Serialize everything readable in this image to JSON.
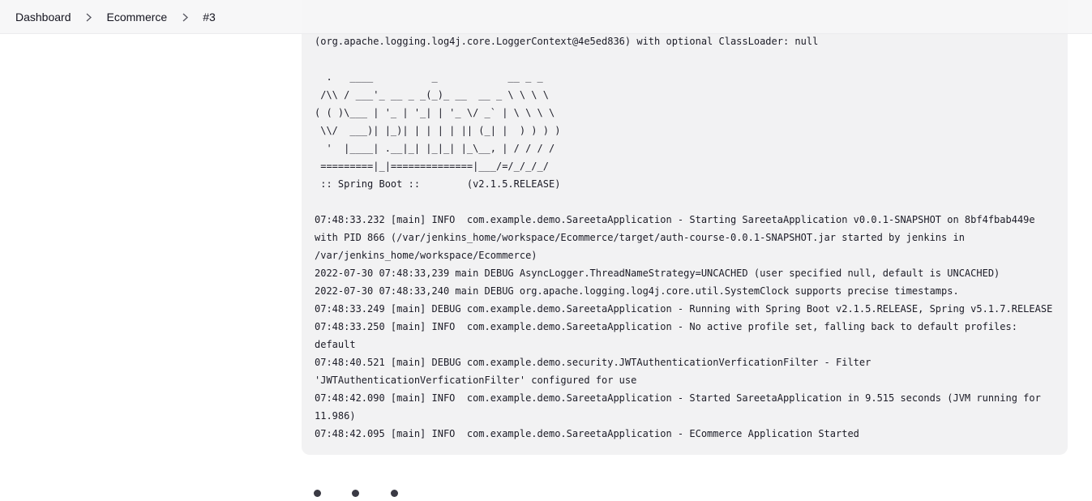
{
  "breadcrumb": {
    "items": [
      {
        "label": "Dashboard"
      },
      {
        "label": "Ecommerce"
      },
      {
        "label": "#3"
      }
    ]
  },
  "console": {
    "lines": [
      "(org.apache.logging.log4j.core.LoggerContext@4e5ed836) with optional ClassLoader: null",
      "",
      "  .   ____          _            __ _ _",
      " /\\\\ / ___'_ __ _ _(_)_ __  __ _ \\ \\ \\ \\",
      "( ( )\\___ | '_ | '_| | '_ \\/ _` | \\ \\ \\ \\",
      " \\\\/  ___)| |_)| | | | | || (_| |  ) ) ) )",
      "  '  |____| .__|_| |_|_| |_\\__, | / / / /",
      " =========|_|==============|___/=/_/_/_/",
      " :: Spring Boot ::        (v2.1.5.RELEASE)",
      "",
      "07:48:33.232 [main] INFO  com.example.demo.SareetaApplication - Starting SareetaApplication v0.0.1-SNAPSHOT on 8bf4fbab449e",
      "with PID 866 (/var/jenkins_home/workspace/Ecommerce/target/auth-course-0.0.1-SNAPSHOT.jar started by jenkins in",
      "/var/jenkins_home/workspace/Ecommerce)",
      "2022-07-30 07:48:33,239 main DEBUG AsyncLogger.ThreadNameStrategy=UNCACHED (user specified null, default is UNCACHED)",
      "2022-07-30 07:48:33,240 main DEBUG org.apache.logging.log4j.core.util.SystemClock supports precise timestamps.",
      "07:48:33.249 [main] DEBUG com.example.demo.SareetaApplication - Running with Spring Boot v2.1.5.RELEASE, Spring v5.1.7.RELEASE",
      "07:48:33.250 [main] INFO  com.example.demo.SareetaApplication - No active profile set, falling back to default profiles:",
      "default",
      "07:48:40.521 [main] DEBUG com.example.demo.security.JWTAuthenticationVerficationFilter - Filter",
      "'JWTAuthenticationVerficationFilter' configured for use",
      "07:48:42.090 [main] INFO  com.example.demo.SareetaApplication - Started SareetaApplication in 9.515 seconds (JVM running for",
      "11.986)",
      "07:48:42.095 [main] INFO  com.example.demo.SareetaApplication - ECommerce Application Started"
    ]
  },
  "icons": {
    "breadcrumb_separator": "chevron-right-icon",
    "loading": "loading-dots-icon"
  },
  "colors": {
    "console_background": "#f2f2f3",
    "text": "#1b1b26",
    "spinner_dot": "#3a3a44"
  }
}
